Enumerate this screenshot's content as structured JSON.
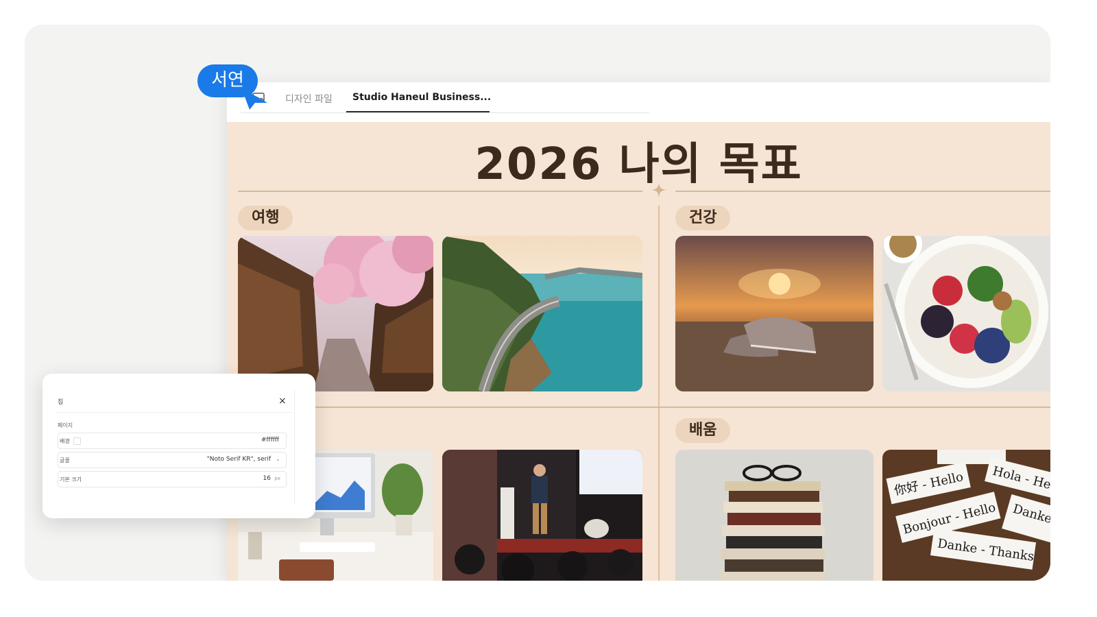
{
  "user": {
    "name": "서연",
    "color": "#1a7ae8"
  },
  "tabs": [
    {
      "label": "디자인 파일",
      "active": false
    },
    {
      "label": "Studio Haneul Business...",
      "active": true
    }
  ],
  "board": {
    "title": "2026 나의 목표",
    "background": "#f6e4d4",
    "sections": [
      {
        "label": "여행",
        "photos": [
          "cherry-blossom-street",
          "coastal-highway"
        ]
      },
      {
        "label": "건강",
        "photos": [
          "running-shoes-sunset",
          "healthy-bowl"
        ]
      },
      {
        "label": "",
        "photos": [
          "desk-computer",
          "conference-speaker"
        ]
      },
      {
        "label": "배움",
        "photos": [
          "stack-of-books-glasses",
          "language-flashcards"
        ]
      }
    ]
  },
  "flashcards": [
    "你好 - Hello",
    "Hola - He",
    "Bonjour - Hello",
    "Danke Than",
    "Danke - Thanks"
  ],
  "panel": {
    "title": "집",
    "close": "×",
    "section": "페이지",
    "rows": [
      {
        "label": "배경",
        "value": "#ffffff"
      },
      {
        "label": "글꼴",
        "value": "\"Noto Serif KR\", serif"
      },
      {
        "label": "기본 크기",
        "value": "16",
        "unit": "px"
      }
    ]
  }
}
